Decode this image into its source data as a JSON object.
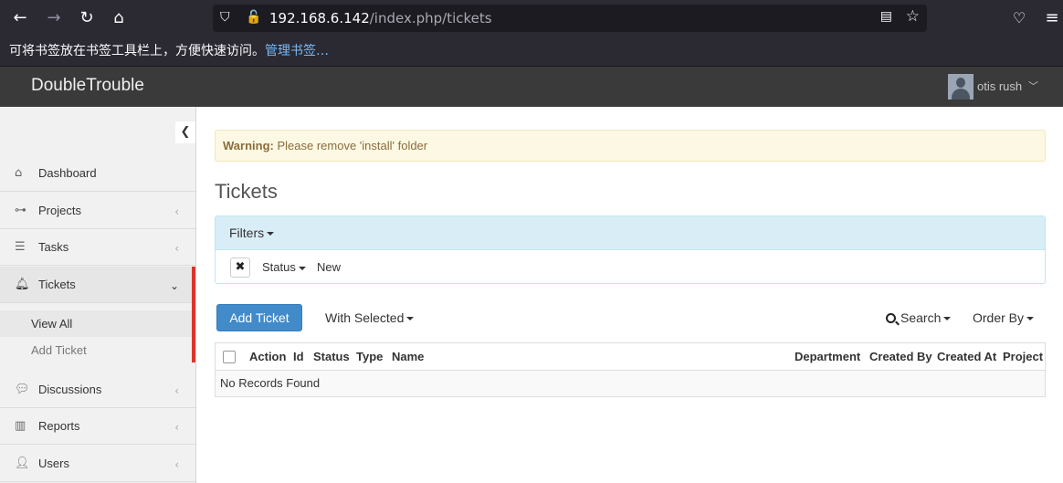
{
  "browser": {
    "url_host": "192.168.6.142",
    "url_path": "/index.php/tickets",
    "bookmarks_text": "可将书签放在书签工具栏上，方便快速访问。",
    "bookmarks_link": "管理书签…"
  },
  "app": {
    "brand": "DoubleTrouble",
    "user_name": "otis rush"
  },
  "sidebar": {
    "items": [
      {
        "label": "Dashboard",
        "icon": "home-icon"
      },
      {
        "label": "Projects",
        "icon": "sitemap-icon"
      },
      {
        "label": "Tasks",
        "icon": "tasks-icon"
      },
      {
        "label": "Tickets",
        "icon": "bell-icon"
      },
      {
        "label": "Discussions",
        "icon": "comments-icon"
      },
      {
        "label": "Reports",
        "icon": "bar-chart-icon"
      },
      {
        "label": "Users",
        "icon": "user-icon"
      }
    ],
    "sub_items": [
      "View All",
      "Add Ticket"
    ]
  },
  "main": {
    "alert_strong": "Warning:",
    "alert_text": "Please remove 'install' folder",
    "title": "Tickets",
    "filters_label": "Filters",
    "filter_field": "Status",
    "filter_value": "New",
    "add_button": "Add Ticket",
    "with_selected": "With Selected",
    "search": "Search",
    "order_by": "Order By",
    "columns": [
      "Action",
      "Id",
      "Status",
      "Type",
      "Name",
      "Department",
      "Created By",
      "Created At",
      "Project"
    ],
    "empty_text": "No Records Found"
  },
  "colors": {
    "accent": "#428bca",
    "active_bar": "#d9362b",
    "alert_bg": "#fcf8e3",
    "filters_bg": "#d9edf7"
  }
}
